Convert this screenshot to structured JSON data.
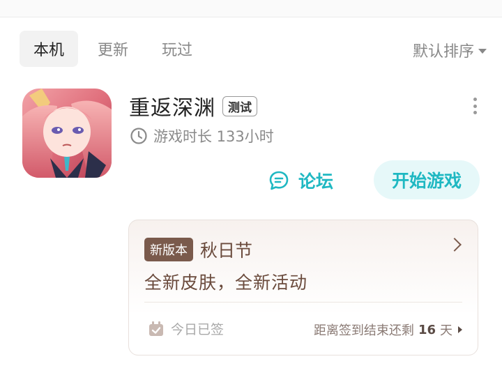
{
  "tabs": [
    {
      "label": "本机",
      "active": true
    },
    {
      "label": "更新",
      "active": false
    },
    {
      "label": "玩过",
      "active": false
    }
  ],
  "sort": {
    "label": "默认排序"
  },
  "game": {
    "title": "重返深渊",
    "badge": "测试",
    "playtime": "游戏时长 133小时",
    "icon": "game-artwork"
  },
  "actions": {
    "forum_label": "论坛",
    "start_label": "开始游戏"
  },
  "event": {
    "badge": "新版本",
    "name": "秋日节",
    "description": "全新皮肤，全新活动",
    "checkin_label": "今日已签",
    "remaining_prefix": "距离签到结束还剩",
    "remaining_days": "16",
    "remaining_unit": "天"
  },
  "colors": {
    "accent": "#1fb8c2",
    "accent_bg": "#e6f8f9",
    "event_brown": "#7a5a4c"
  }
}
